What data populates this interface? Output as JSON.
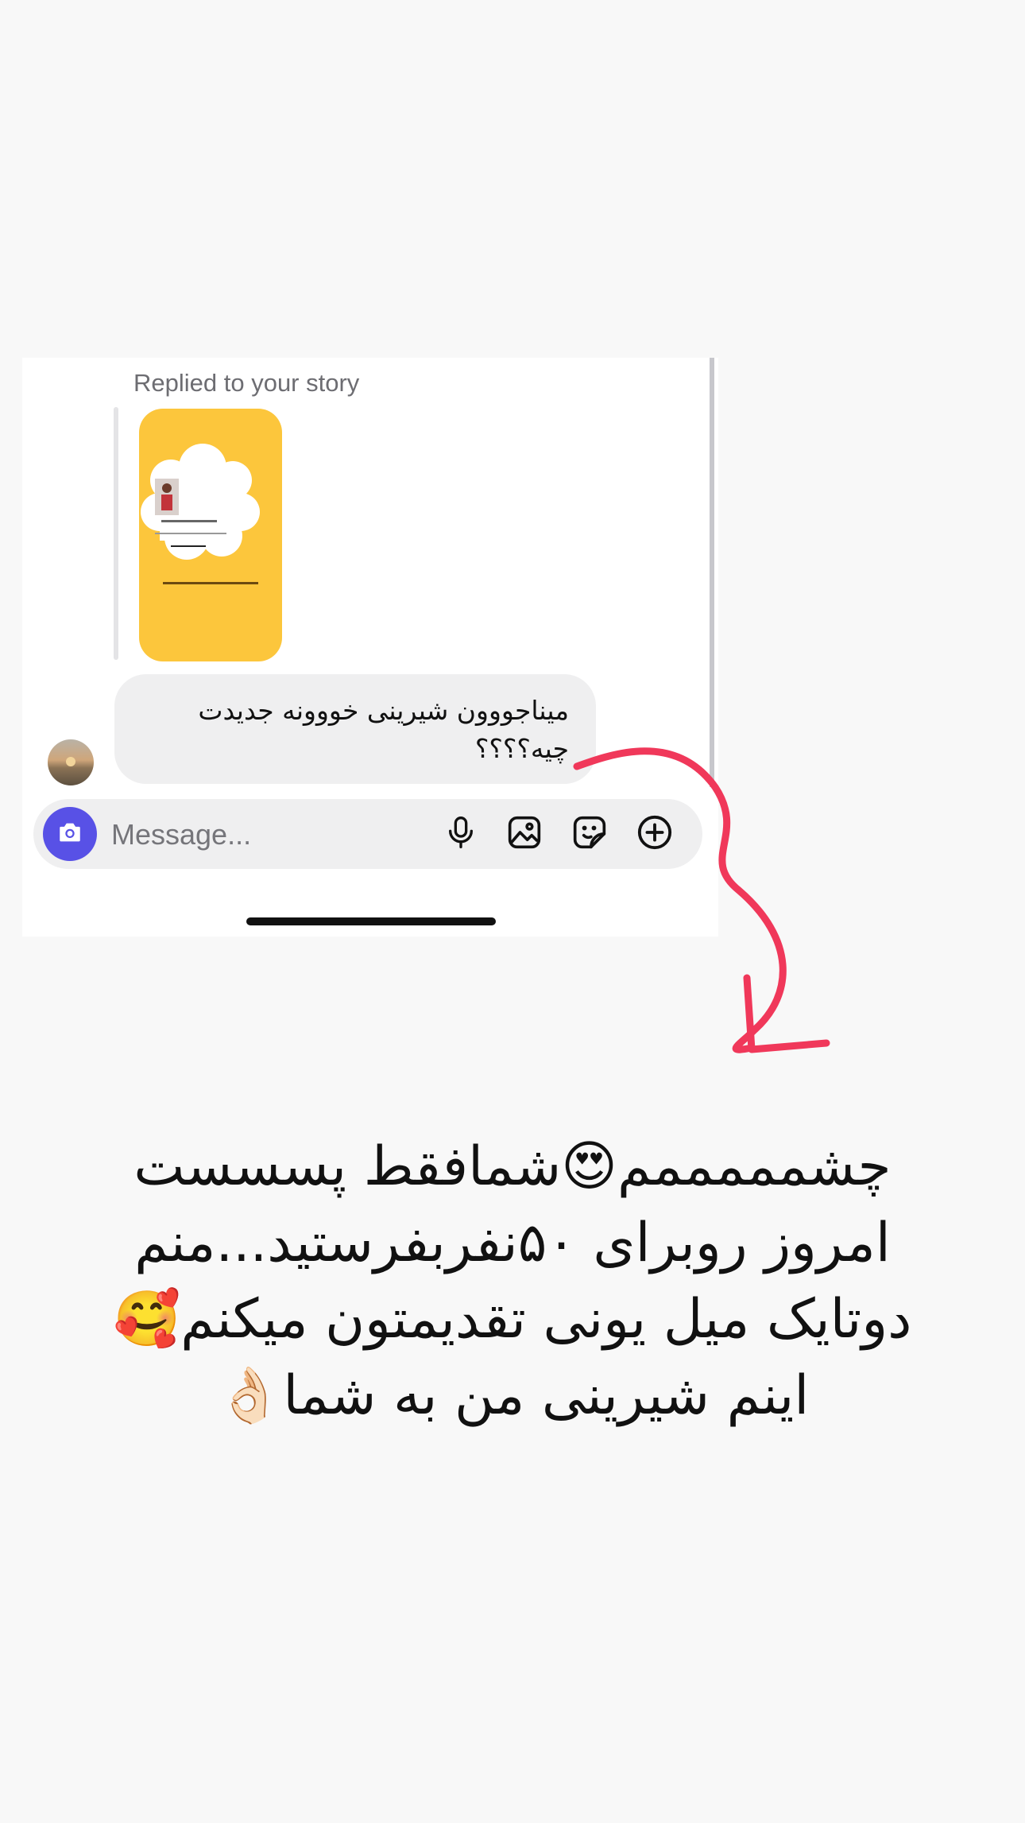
{
  "story_reply": {
    "caption": "Replied to your story",
    "story_preview_icon": "story-thumbnail",
    "message": "میناجووون شیرینی خووونه جدیدت چیه؟؟؟؟"
  },
  "composer": {
    "placeholder": "Message...",
    "icons": [
      "camera-icon",
      "microphone-icon",
      "gallery-icon",
      "sticker-icon",
      "plus-icon"
    ]
  },
  "annotation": {
    "arrow_color": "#f0385a"
  },
  "caption": {
    "lines": [
      "چشمممممم😍شمافقط پسسست",
      "امروز روبرای ۵۰نفربفرستید...منم",
      "دوتایک میل یونی تقدیمتون میکنم🥰",
      "اینم شیرینی من به شما👌🏻"
    ]
  },
  "colors": {
    "background": "#f8f8f8",
    "accent": "#5851e6",
    "story_background": "#fcc63c",
    "bubble": "#efeff0"
  }
}
